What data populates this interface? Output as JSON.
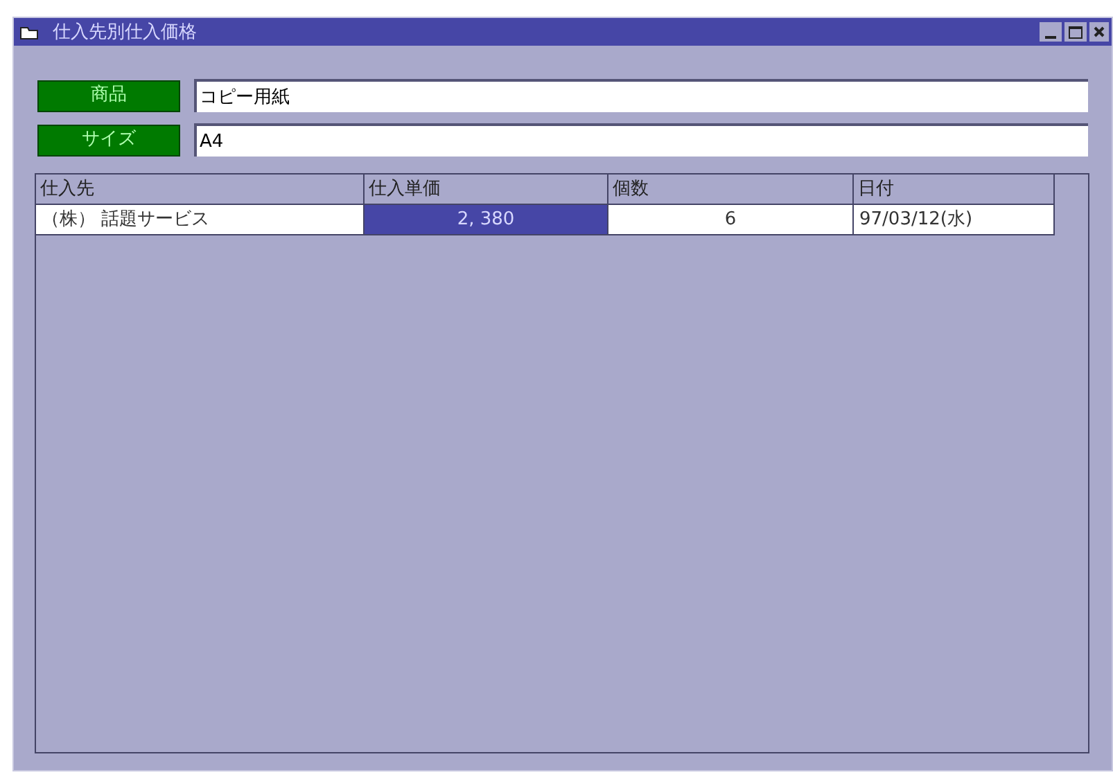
{
  "window": {
    "title": "仕入先別仕入価格"
  },
  "fields": [
    {
      "label": "商品",
      "value": "コピー用紙"
    },
    {
      "label": "サイズ",
      "value": "A4"
    }
  ],
  "table": {
    "columns": [
      "仕入先",
      "仕入単価",
      "個数",
      "日付"
    ],
    "rows": [
      {
        "cells": [
          {
            "text": "（株） 話題サービス",
            "selected": false
          },
          {
            "text": "2, 380",
            "selected": true
          },
          {
            "text": "6",
            "selected": false
          },
          {
            "text": "97/03/12(水)",
            "selected": false
          }
        ]
      }
    ]
  }
}
